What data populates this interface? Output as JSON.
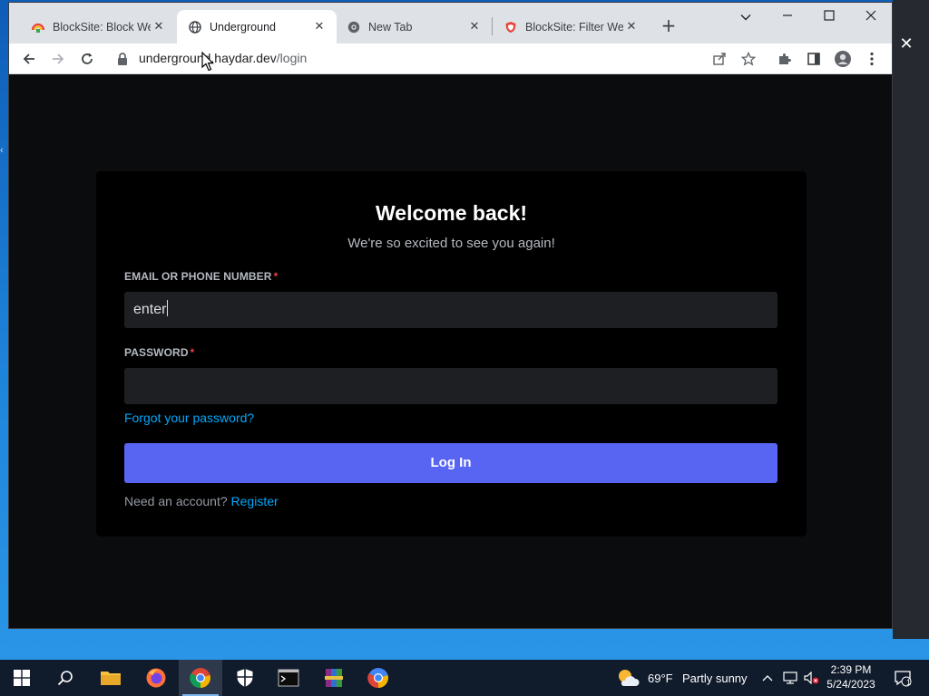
{
  "browser": {
    "tabs": [
      {
        "title": "BlockSite: Block Web",
        "favicon": "blocksite-rainbow-icon",
        "active": false
      },
      {
        "title": "Underground",
        "favicon": "globe-icon",
        "active": true
      },
      {
        "title": "New Tab",
        "favicon": "chrome-icon",
        "active": false
      },
      {
        "title": "BlockSite: Filter Web",
        "favicon": "blocksite-shield-icon",
        "active": false
      }
    ],
    "new_tab_label": "+",
    "address": {
      "host": "underground.haydar.dev",
      "path": "/login"
    }
  },
  "page": {
    "heading": "Welcome back!",
    "subheading": "We're so excited to see you again!",
    "email_label": "EMAIL OR PHONE NUMBER",
    "email_value": "enter",
    "password_label": "PASSWORD",
    "password_value": "",
    "required_mark": "*",
    "forgot_link": "Forgot your password?",
    "login_button": "Log In",
    "need_account": "Need an account?",
    "register_link": "Register"
  },
  "taskbar": {
    "weather": {
      "temp": "69°F",
      "condition": "Partly sunny"
    },
    "clock": {
      "time": "2:39 PM",
      "date": "5/24/2023"
    },
    "notification_count": "1"
  },
  "colors": {
    "accent": "#5865f2",
    "link": "#00a8fc",
    "card": "#000000",
    "input": "#1e1f22",
    "required": "#f23f43"
  }
}
